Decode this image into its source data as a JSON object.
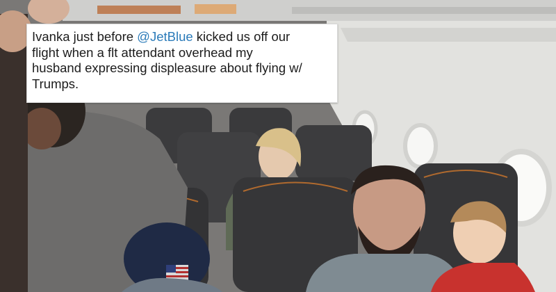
{
  "tweet": {
    "line1_before": "Ivanka just before ",
    "mention": "@JetBlue",
    "line1_after": " kicked us off our",
    "line2": "flight when a flt attendant overhead my",
    "line3": "husband expressing displeasure about flying w/",
    "line4": "Trumps."
  },
  "colors": {
    "mention": "#2b7bb9",
    "cabin_wall": "#dcdcd9",
    "seat": "#3a3a3c",
    "seat_trim": "#b06a2e"
  }
}
